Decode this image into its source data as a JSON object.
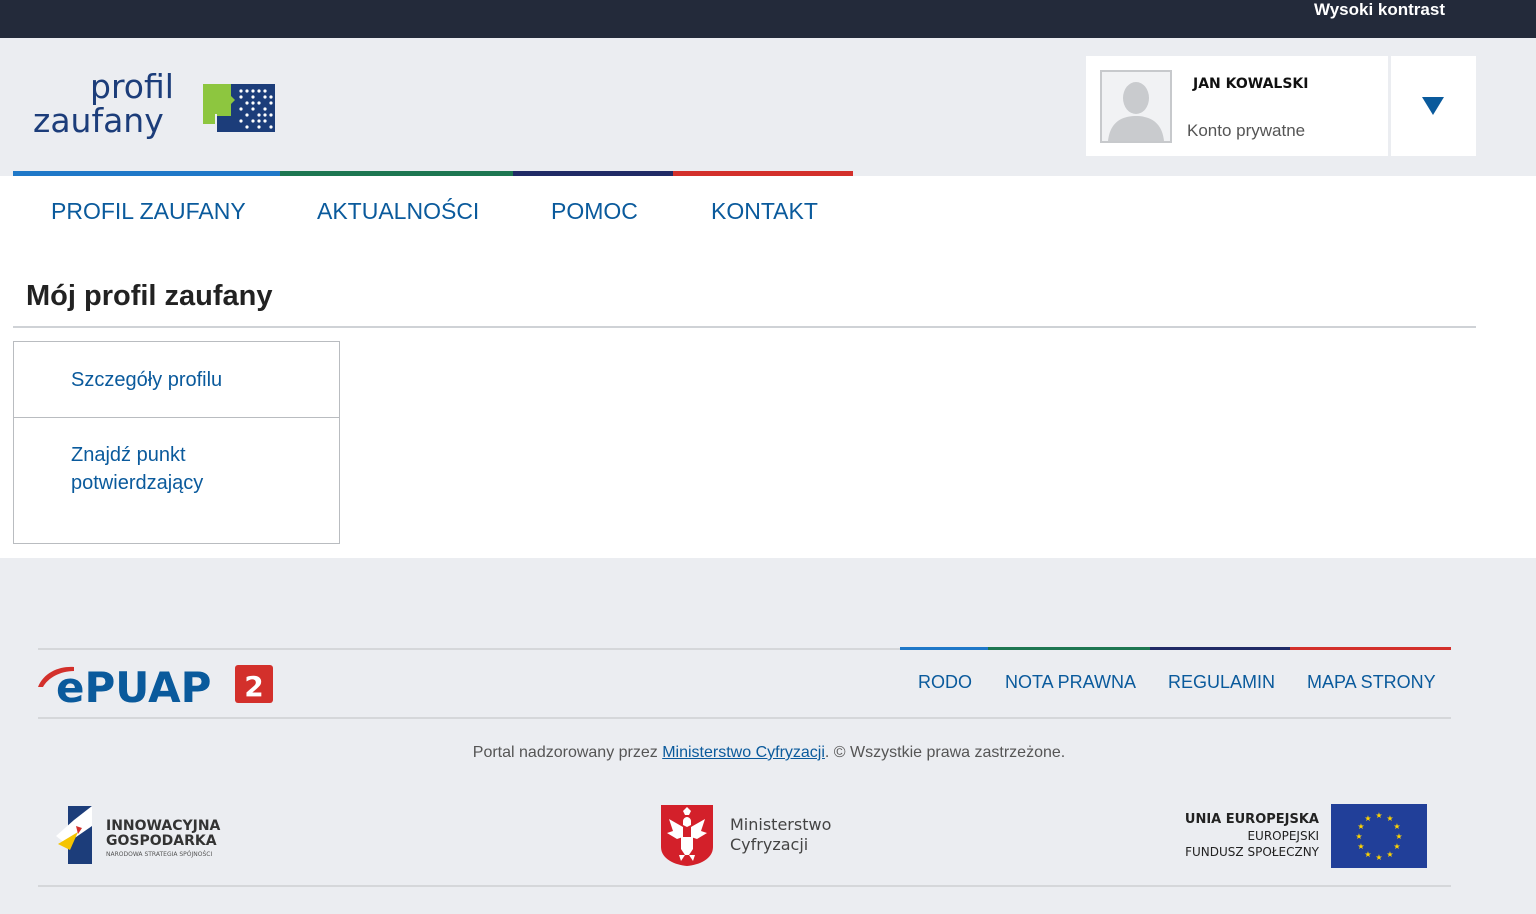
{
  "topbar": {
    "contrast_label": "Wysoki kontrast"
  },
  "logo": {
    "line1": "profil",
    "line2": "zaufany"
  },
  "user": {
    "name": "JAN KOWALSKI",
    "account_type": "Konto prywatne"
  },
  "nav": {
    "items": [
      {
        "label": "PROFIL ZAUFANY"
      },
      {
        "label": "AKTUALNOŚCI"
      },
      {
        "label": "POMOC"
      },
      {
        "label": "KONTAKT"
      }
    ]
  },
  "page": {
    "title": "Mój profil zaufany"
  },
  "side_menu": {
    "items": [
      {
        "label": "Szczegóły profilu"
      },
      {
        "label": "Znajdź punkt potwierdzający"
      }
    ]
  },
  "footer": {
    "epuap_logo_text": "ePUAP",
    "epuap_version": "2",
    "links": [
      {
        "label": "RODO"
      },
      {
        "label": "NOTA PRAWNA"
      },
      {
        "label": "REGULAMIN"
      },
      {
        "label": "MAPA STRONY"
      }
    ],
    "copyright_prefix": "Portal nadzorowany przez ",
    "copyright_link": "Ministerstwo Cyfryzacji",
    "copyright_suffix": ". © Wszystkie prawa zastrzeżone.",
    "logos": {
      "ig_line1": "INNOWACYJNA",
      "ig_line2": "GOSPODARKA",
      "ig_sub": "NARODOWA STRATEGIA SPÓJNOŚCI",
      "mc_line1": "Ministerstwo",
      "mc_line2": "Cyfryzacji",
      "eu_line1": "UNIA EUROPEJSKA",
      "eu_line2": "EUROPEJSKI",
      "eu_line3": "FUNDUSZ SPOŁECZNY"
    }
  },
  "colors": {
    "topbar": "#232a3a",
    "link": "#0a5a9c",
    "stripe_blue": "#1f78c8",
    "stripe_green": "#1d7651",
    "stripe_navy": "#202a66",
    "stripe_red": "#d3302b",
    "logo_green": "#8dc63f"
  }
}
